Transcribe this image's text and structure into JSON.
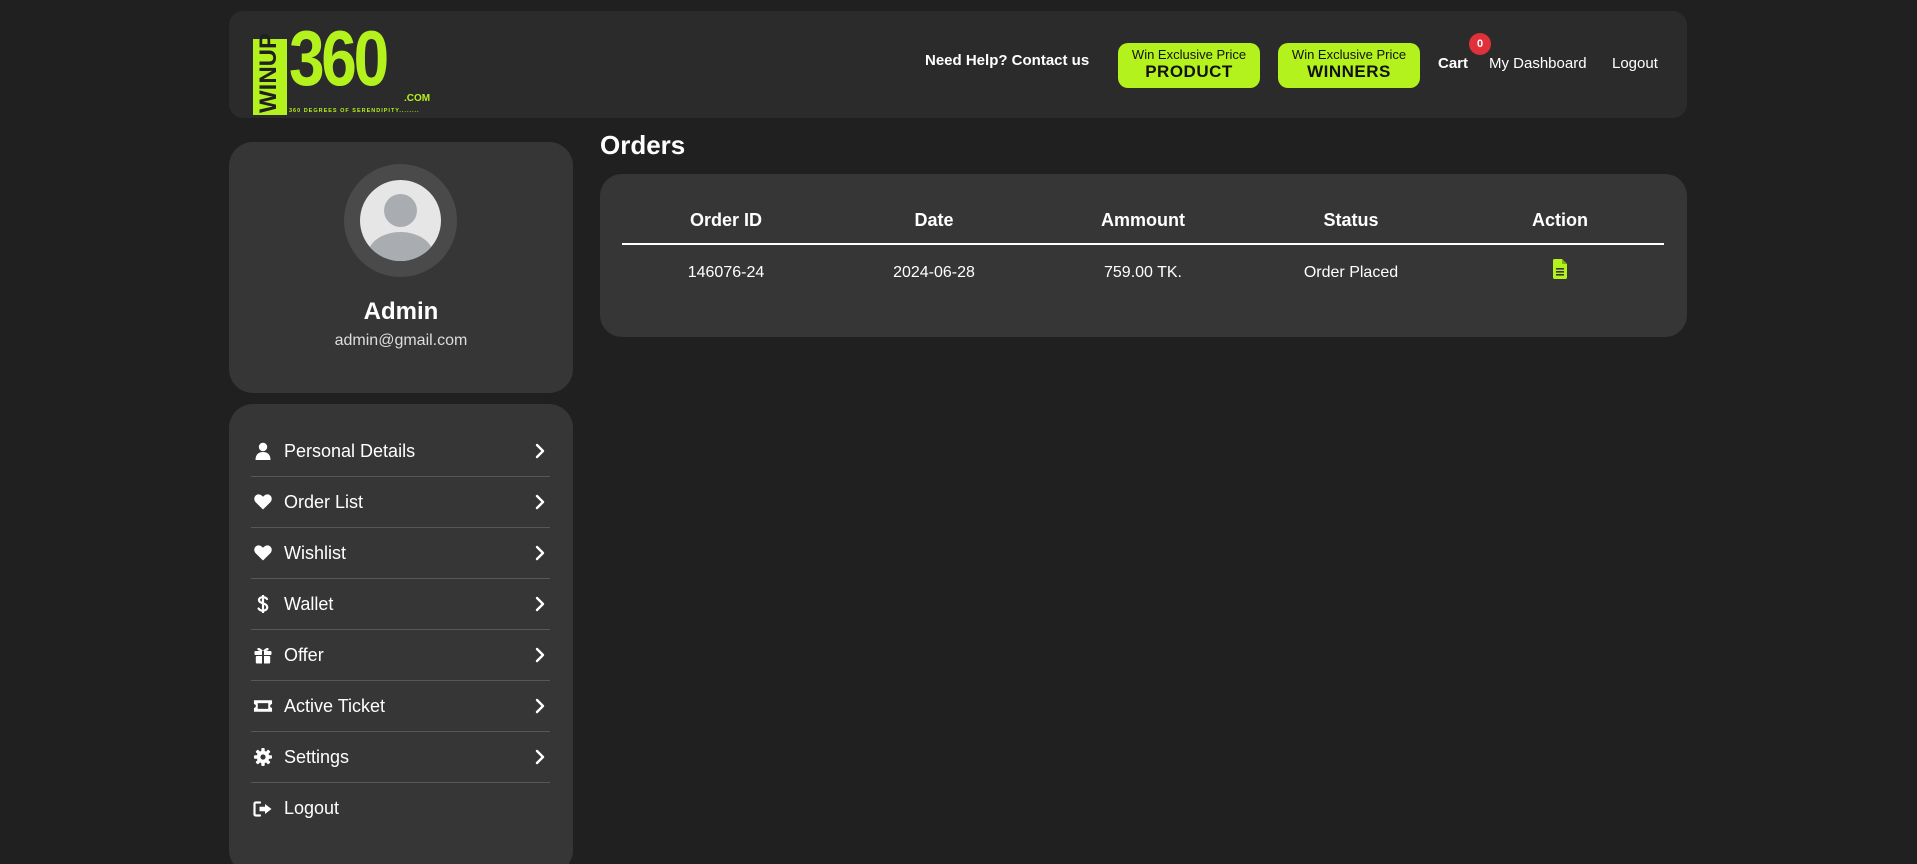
{
  "header": {
    "logo": {
      "text_main": "360",
      "text_side": "WINUP",
      "suffix": ".COM",
      "tagline": "360 DEGREES OF SERENDIPITY........"
    },
    "help_link": "Need Help? Contact us",
    "promo_product": {
      "small": "Win Exclusive Price",
      "big": "PRODUCT"
    },
    "promo_winners": {
      "small": "Win Exclusive Price",
      "big": "WINNERS"
    },
    "cart_label": "Cart",
    "cart_count": "0",
    "dashboard_link": "My Dashboard",
    "logout_link": "Logout",
    "accent_color": "#b4f21d"
  },
  "profile": {
    "name": "Admin",
    "email": "admin@gmail.com"
  },
  "sidebar": {
    "items": [
      {
        "label": "Personal Details",
        "icon": "user-icon"
      },
      {
        "label": "Order List",
        "icon": "heart-icon"
      },
      {
        "label": "Wishlist",
        "icon": "heart-icon"
      },
      {
        "label": "Wallet",
        "icon": "dollar-icon"
      },
      {
        "label": "Offer",
        "icon": "gift-icon"
      },
      {
        "label": "Active Ticket",
        "icon": "ticket-icon"
      },
      {
        "label": "Settings",
        "icon": "gear-icon"
      },
      {
        "label": "Logout",
        "icon": "logout-icon"
      }
    ]
  },
  "orders": {
    "title": "Orders",
    "columns": [
      "Order ID",
      "Date",
      "Ammount",
      "Status",
      "Action"
    ],
    "rows": [
      {
        "order_id": "146076-24",
        "date": "2024-06-28",
        "amount": "759.00 TK.",
        "status": "Order Placed",
        "action_icon": "document-icon"
      }
    ]
  }
}
